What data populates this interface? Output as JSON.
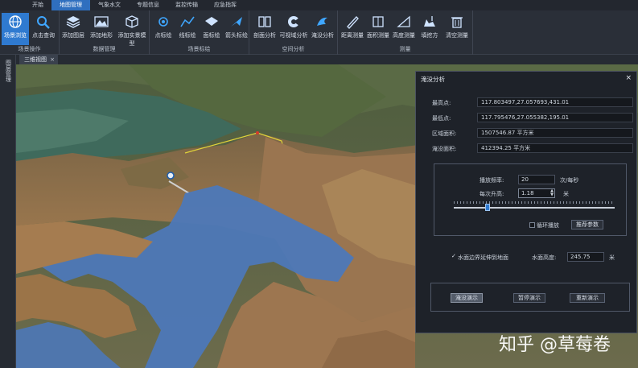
{
  "menubar": {
    "items": [
      "开始",
      "地图管理",
      "气象水文",
      "专题信息",
      "监控传输",
      "应急指挥"
    ],
    "active_index": 1
  },
  "ribbon": {
    "groups": [
      {
        "label": "场景操作",
        "buttons": [
          {
            "label": "场景浏览",
            "icon": "globe-icon"
          },
          {
            "label": "点击查询",
            "icon": "search-icon"
          }
        ]
      },
      {
        "label": "数据管理",
        "buttons": [
          {
            "label": "添加图层",
            "icon": "layers-icon"
          },
          {
            "label": "添加地形",
            "icon": "terrain-icon"
          },
          {
            "label": "添加实景模型",
            "icon": "cube-icon"
          }
        ]
      },
      {
        "label": "场景标绘",
        "buttons": [
          {
            "label": "点标绘",
            "icon": "point-icon"
          },
          {
            "label": "线标绘",
            "icon": "polyline-icon"
          },
          {
            "label": "面标绘",
            "icon": "polygon-icon"
          },
          {
            "label": "箭头标绘",
            "icon": "arrow-icon"
          }
        ]
      },
      {
        "label": "空间分析",
        "buttons": [
          {
            "label": "剖面分析",
            "icon": "profile-icon"
          },
          {
            "label": "可视域分析",
            "icon": "viewshed-icon"
          },
          {
            "label": "淹没分析",
            "icon": "flood-icon"
          }
        ]
      },
      {
        "label": "测量",
        "buttons": [
          {
            "label": "距离测量",
            "icon": "ruler-icon"
          },
          {
            "label": "面积测量",
            "icon": "area-icon"
          },
          {
            "label": "高度测量",
            "icon": "height-icon"
          },
          {
            "label": "填挖方",
            "icon": "cutfill-icon"
          },
          {
            "label": "清空测量",
            "icon": "trash-icon"
          }
        ]
      }
    ]
  },
  "sidebar": {
    "label": "图层管理"
  },
  "doc_tab": {
    "label": "三维视图",
    "close": "×"
  },
  "flood_panel": {
    "title": "淹没分析",
    "close": "×",
    "fields": [
      {
        "label": "最高点:",
        "value": "117.803497,27.057693,431.01"
      },
      {
        "label": "最低点:",
        "value": "117.795476,27.055382,195.01"
      },
      {
        "label": "区域面积:",
        "value": "1507546.87 平方米"
      },
      {
        "label": "淹没面积:",
        "value": "412394.25 平方米"
      }
    ],
    "playback_rate_label": "播放频率:",
    "playback_rate_value": "20",
    "playback_rate_unit": "次/每秒",
    "rise_label": "每次升高:",
    "rise_value": "1.18",
    "rise_unit": "米",
    "slider_level": 0.2,
    "loop_label": "循环播放",
    "recommend_label": "推荐参数",
    "extend_label": "水面边界延伸到地面",
    "extend_checked": true,
    "water_height_label": "水面高度:",
    "water_height_value": "245.75",
    "water_height_unit": "米",
    "actions": [
      "淹没演示",
      "暂停演示",
      "重新演示"
    ],
    "selected_action": 0
  },
  "watermark": "知乎 @草莓卷",
  "colors": {
    "accent": "#2f7ad0",
    "water": "#4d78b8",
    "panel_bg": "#1e2229"
  }
}
